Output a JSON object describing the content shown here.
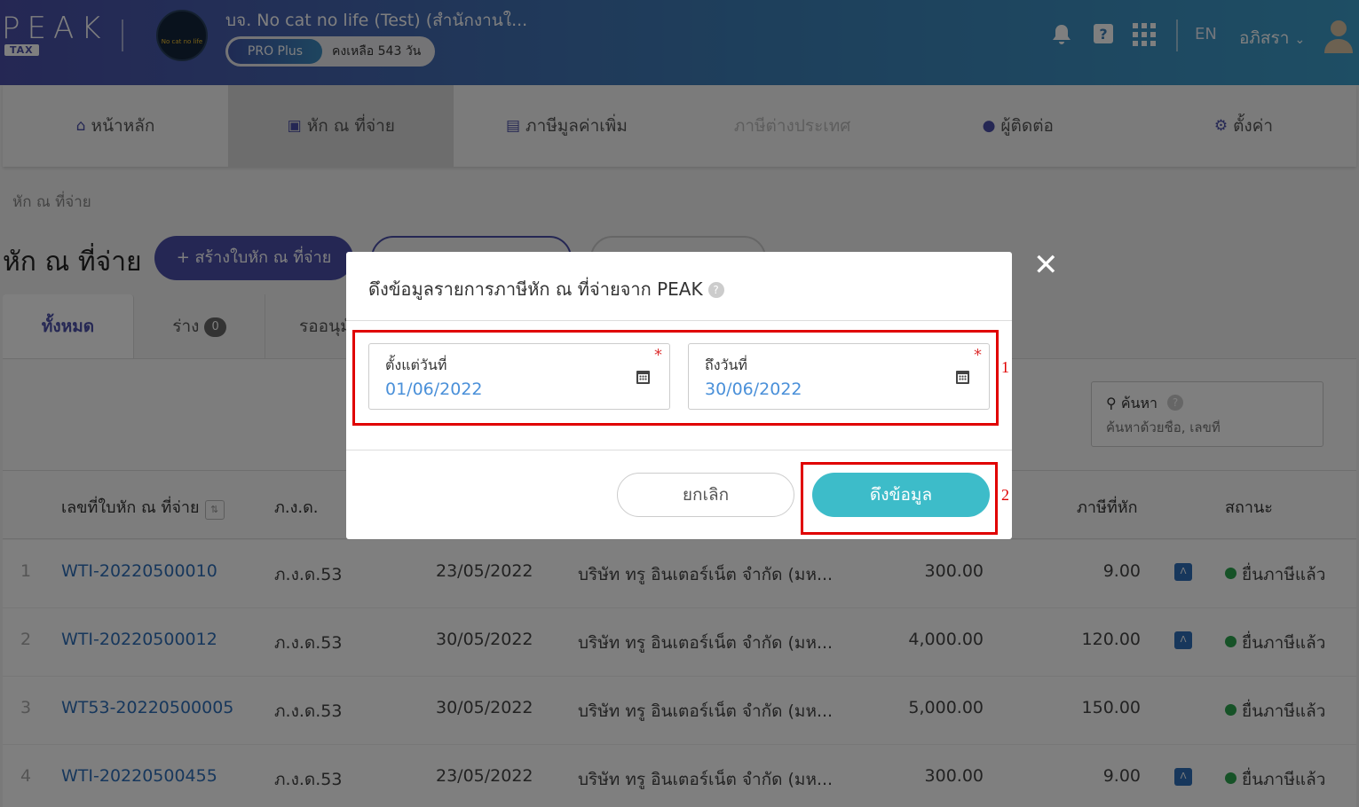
{
  "header": {
    "logo": "PEAK",
    "logo_sub": "TAX",
    "company_logo_text": "No cat no life",
    "company": "บจ. No cat no life (Test) (สำนักงานใ...",
    "plan": "PRO Plus",
    "days_left": "คงเหลือ 543 วัน",
    "lang": "EN",
    "user": "อภิสรา"
  },
  "nav": [
    {
      "label": "หน้าหลัก",
      "icon": "home-icon"
    },
    {
      "label": "หัก ณ ที่จ่าย",
      "icon": "wallet-icon"
    },
    {
      "label": "ภาษีมูลค่าเพิ่ม",
      "icon": "receipt-icon"
    },
    {
      "label": "ภาษีต่างประเทศ",
      "icon": ""
    },
    {
      "label": "ผู้ติดต่อ",
      "icon": "user-icon"
    },
    {
      "label": "ตั้งค่า",
      "icon": "gear-icon"
    }
  ],
  "breadcrumb": "หัก ณ ที่จ่าย",
  "page_title": "หัก ณ ที่จ่าย",
  "create_button": "+ สร้างใบหัก ณ ที่จ่าย",
  "tabs": [
    {
      "label": "ทั้งหมด"
    },
    {
      "label": "ร่าง",
      "count": "0"
    },
    {
      "label": "รออนุมัติ"
    }
  ],
  "search": {
    "label": "ค้นหา",
    "placeholder": "ค้นหาด้วยชื่อ, เลขที่"
  },
  "table": {
    "headers": [
      "เลขที่ใบหัก ณ ที่จ่าย",
      "ภ.ง.ด.",
      "ภาษีที่หัก",
      "สถานะ"
    ],
    "rows": [
      {
        "num": "1",
        "doc": "WTI-20220500010",
        "form": "ภ.ง.ด.53",
        "date": "23/05/2022",
        "contact": "บริษัท ทรู อินเตอร์เน็ต จำกัด (มห...",
        "amount": "300.00",
        "tax": "9.00",
        "peak": true,
        "status": "ยื่นภาษีแล้ว"
      },
      {
        "num": "2",
        "doc": "WTI-20220500012",
        "form": "ภ.ง.ด.53",
        "date": "30/05/2022",
        "contact": "บริษัท ทรู อินเตอร์เน็ต จำกัด (มห...",
        "amount": "4,000.00",
        "tax": "120.00",
        "peak": true,
        "status": "ยื่นภาษีแล้ว"
      },
      {
        "num": "3",
        "doc": "WT53-20220500005",
        "form": "ภ.ง.ด.53",
        "date": "30/05/2022",
        "contact": "บริษัท ทรู อินเตอร์เน็ต จำกัด (มห...",
        "amount": "5,000.00",
        "tax": "150.00",
        "peak": false,
        "status": "ยื่นภาษีแล้ว"
      },
      {
        "num": "4",
        "doc": "WTI-20220500455",
        "form": "ภ.ง.ด.53",
        "date": "23/05/2022",
        "contact": "บริษัท ทรู อินเตอร์เน็ต จำกัด (มห...",
        "amount": "300.00",
        "tax": "9.00",
        "peak": true,
        "status": "ยื่นภาษีแล้ว"
      }
    ]
  },
  "modal": {
    "title": "ดึงข้อมูลรายการภาษีหัก ณ ที่จ่ายจาก PEAK",
    "from_label": "ตั้งแต่วันที่",
    "from_value": "01/06/2022",
    "to_label": "ถึงวันที่",
    "to_value": "30/06/2022",
    "cancel": "ยกเลิก",
    "fetch": "ดึงข้อมูล",
    "annotation_1": "1",
    "annotation_2": "2"
  },
  "colors": {
    "brand": "#4a4fa8",
    "accent": "#3dbcc9",
    "annotation": "#e00000",
    "status_ok": "#2da44e"
  }
}
